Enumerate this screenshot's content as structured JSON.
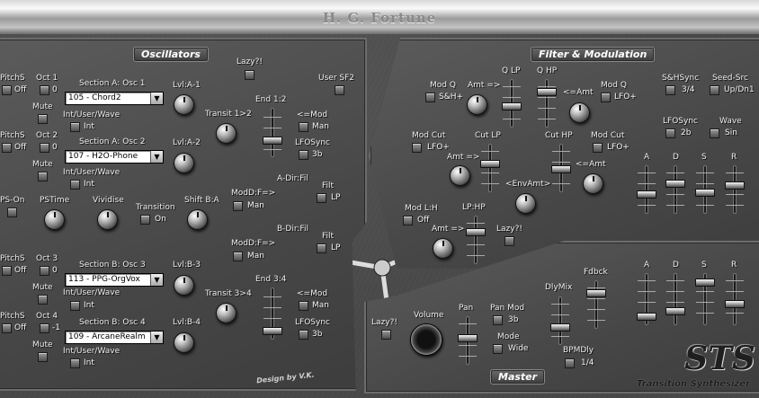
{
  "app_title": "H. G. Fortune",
  "sections": {
    "oscillators": "Oscillators",
    "filter": "Filter & Modulation",
    "master": "Master"
  },
  "credit": "Design by V.K.",
  "brand": {
    "logo": "STS",
    "subtitle": "Transition Synthesizer"
  },
  "osc": {
    "lazy": "Lazy?!",
    "user_sf2": "User SF2",
    "pitchs": "PitchS",
    "off": "Off",
    "mute": "Mute",
    "int_user_wave": "Int/User/Wave",
    "int": "Int",
    "rows": [
      {
        "oct": "Oct 1",
        "oct_val": "0",
        "section": "Section A: Osc 1",
        "wave": "105 - Chord2",
        "lvl": "Lvl:A-1"
      },
      {
        "oct": "Oct 2",
        "oct_val": "0",
        "section": "Section A: Osc 2",
        "wave": "107 - H2O-Phone",
        "lvl": "Lvl:A-2"
      },
      {
        "oct": "Oct 3",
        "oct_val": "0",
        "section": "Section B: Osc 3",
        "wave": "113 - PPG-OrgVox",
        "lvl": "Lvl:B-3"
      },
      {
        "oct": "Oct 4",
        "oct_val": "-1",
        "section": "Section B: Osc 4",
        "wave": "109 - ArcaneRealm",
        "lvl": "Lvl:B-4"
      }
    ],
    "transit_12": "Transit 1>2",
    "end_12": "End 1:2",
    "mod": "<=Mod",
    "man": "Man",
    "lfosync": "LFOSync",
    "lfosync_val": "3b",
    "ps_on": "PS-On",
    "pstime": "PSTime",
    "vividise": "Vividise",
    "transition": "Transition",
    "on": "On",
    "shift_ba": "Shift B:A",
    "modd": "ModD:F=>",
    "adir": "A-Dir:Fil",
    "bdir": "B-Dir:Fil",
    "filt": "Filt",
    "lp": "LP",
    "transit_34": "Transit 3>4",
    "end_34": "End 3:4"
  },
  "flt": {
    "mod_q": "Mod Q",
    "sh": "S&H+",
    "amt_r": "Amt =>",
    "amt_l": "<=Amt",
    "q_lp": "Q LP",
    "q_hp": "Q HP",
    "lfo_plus": "LFO+",
    "mod_cut": "Mod Cut",
    "cut_lp": "Cut LP",
    "cut_hp": "Cut HP",
    "env_amt": "<EnvAmt>",
    "mod_lh": "Mod L:H",
    "off": "Off",
    "lphp": "LP:HP",
    "lazy": "Lazy?!",
    "shsync": "S&HSync",
    "shsync_val": "3/4",
    "seed": "Seed-Src",
    "seed_val": "Up/Dn1",
    "lfosync": "LFOSync",
    "lfosync_val": "2b",
    "wave": "Wave",
    "wave_val": "Sin",
    "adsr": [
      "A",
      "D",
      "S",
      "R"
    ]
  },
  "mst": {
    "lazy": "Lazy?!",
    "volume": "Volume",
    "pan": "Pan",
    "panmod": "Pan Mod",
    "panmod_val": "3b",
    "mode": "Mode",
    "mode_val": "Wide",
    "dlymix": "DlyMix",
    "fdbck": "Fdbck",
    "bpmdly": "BPMDly",
    "bpmdly_val": "1/4",
    "adsr": [
      "A",
      "D",
      "S",
      "R"
    ]
  }
}
